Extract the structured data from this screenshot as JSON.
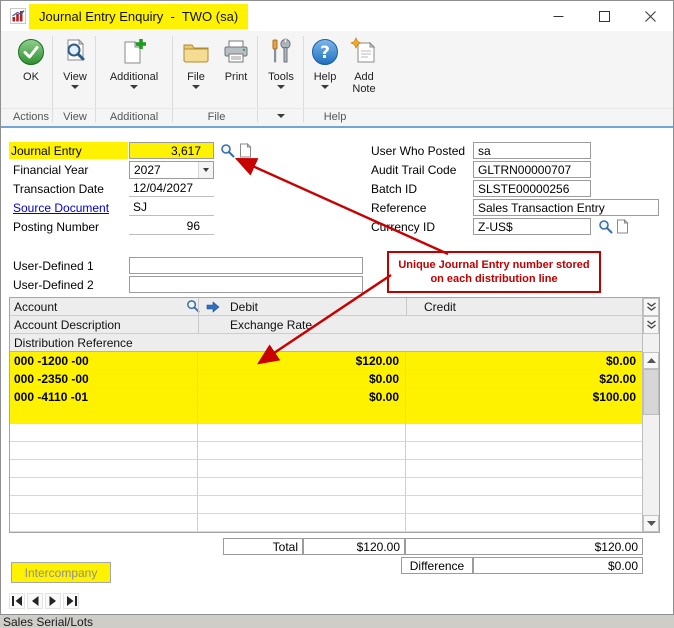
{
  "window": {
    "title": "Journal Entry Enquiry  -  TWO (sa)"
  },
  "ribbon": {
    "buttons": [
      {
        "label": "OK"
      },
      {
        "label": "View"
      },
      {
        "label": "Additional"
      },
      {
        "label": "File"
      },
      {
        "label": "Print"
      },
      {
        "label": "Tools"
      },
      {
        "label": "Help"
      },
      {
        "label": "Add Note"
      }
    ],
    "groups": [
      {
        "label": "Actions"
      },
      {
        "label": "View"
      },
      {
        "label": "Additional"
      },
      {
        "label": "File"
      },
      {
        "label": "Help"
      }
    ]
  },
  "fields": {
    "journal_entry": {
      "label": "Journal Entry",
      "value": "3,617"
    },
    "financial_year": {
      "label": "Financial Year",
      "value": "2027"
    },
    "transaction_date": {
      "label": "Transaction Date",
      "value": "12/04/2027"
    },
    "source_document": {
      "label": "Source Document",
      "value": "SJ"
    },
    "posting_number": {
      "label": "Posting Number",
      "value": "96"
    },
    "user_who_posted": {
      "label": "User Who Posted",
      "value": "sa"
    },
    "audit_trail_code": {
      "label": "Audit Trail Code",
      "value": "GLTRN00000707"
    },
    "batch_id": {
      "label": "Batch ID",
      "value": "SLSTE00000256"
    },
    "reference": {
      "label": "Reference",
      "value": "Sales Transaction Entry"
    },
    "currency_id": {
      "label": "Currency ID",
      "value": "Z-US$"
    },
    "user_defined_1": {
      "label": "User-Defined 1",
      "value": ""
    },
    "user_defined_2": {
      "label": "User-Defined 2",
      "value": ""
    }
  },
  "annotation": {
    "text": "Unique Journal Entry number stored\non each distribution line"
  },
  "grid": {
    "header": {
      "account": "Account",
      "debit": "Debit",
      "credit": "Credit",
      "account_description": "Account Description",
      "exchange_rate": "Exchange Rate",
      "distribution_reference": "Distribution Reference"
    },
    "rows": [
      {
        "account": "000 -1200 -00",
        "debit": "$120.00",
        "credit": "$0.00"
      },
      {
        "account": "000 -2350 -00",
        "debit": "$0.00",
        "credit": "$20.00"
      },
      {
        "account": "000 -4110 -01",
        "debit": "$0.00",
        "credit": "$100.00"
      }
    ],
    "totals": {
      "label": "Total",
      "debit": "$120.00",
      "credit": "$120.00"
    },
    "difference": {
      "label": "Difference",
      "value": "$0.00"
    }
  },
  "footer": {
    "intercompany": "Intercompany",
    "background_window_text": "Sales Serial/Lots"
  },
  "colors": {
    "highlight": "#fff200",
    "annotation_red": "#c00000",
    "link_blue": "#0000cc",
    "ribbon_line_blue": "#6ea6d8"
  }
}
